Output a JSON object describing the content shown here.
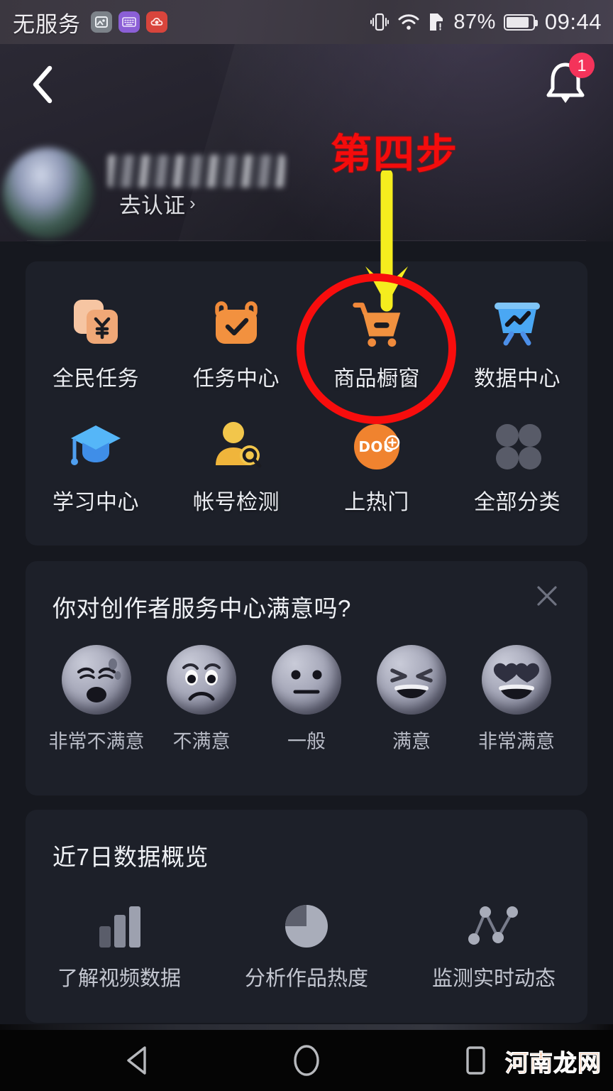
{
  "status_bar": {
    "carrier": "无服务",
    "icons": [
      "screenshot-icon",
      "keyboard-icon",
      "cloud-icon"
    ],
    "vibrate_icon": "vibrate-icon",
    "wifi_icon": "wifi-icon",
    "sim_alert_icon": "sim-alert-icon",
    "battery_percent": "87%",
    "battery_icon": "battery-icon",
    "clock": "09:44"
  },
  "header": {
    "back_icon": "back-chevron-icon",
    "bell_icon": "bell-icon",
    "bell_badge": "1",
    "avatar": "avatar",
    "username": "",
    "verify_label": "去认证",
    "verify_chevron": "›"
  },
  "annotation": {
    "step_text": "第四步",
    "arrow": "down-arrow-annotation",
    "highlight_circle": "red-highlight-circle",
    "arrow_color": "#f5ed1e",
    "circle_color": "#f80d0d",
    "text_color": "#f40c0c"
  },
  "grid": {
    "row1": [
      {
        "label": "全民任务",
        "icon": "yen-cards-icon"
      },
      {
        "label": "任务中心",
        "icon": "task-check-icon"
      },
      {
        "label": "商品橱窗",
        "icon": "shopping-cart-icon"
      },
      {
        "label": "数据中心",
        "icon": "data-board-icon"
      }
    ],
    "row2": [
      {
        "label": "学习中心",
        "icon": "graduation-cap-icon"
      },
      {
        "label": "帐号检测",
        "icon": "account-search-icon"
      },
      {
        "label": "上热门",
        "icon": "dou-plus-icon"
      },
      {
        "label": "全部分类",
        "icon": "grid-dots-icon"
      }
    ]
  },
  "survey": {
    "title": "你对创作者服务中心满意吗?",
    "close_icon": "close-icon",
    "options": [
      {
        "label": "非常不满意",
        "icon": "face-very-dissatisfied"
      },
      {
        "label": "不满意",
        "icon": "face-dissatisfied"
      },
      {
        "label": "一般",
        "icon": "face-neutral"
      },
      {
        "label": "满意",
        "icon": "face-satisfied"
      },
      {
        "label": "非常满意",
        "icon": "face-very-satisfied"
      }
    ]
  },
  "data_overview": {
    "title": "近7日数据概览",
    "items": [
      {
        "label": "了解视频数据",
        "icon": "bar-chart-icon"
      },
      {
        "label": "分析作品热度",
        "icon": "pie-chart-icon"
      },
      {
        "label": "监测实时动态",
        "icon": "line-chart-icon"
      }
    ]
  },
  "navbar": {
    "back": "nav-back-triangle-icon",
    "home": "nav-home-circle-icon",
    "recents": "nav-recents-square-icon"
  },
  "watermark": {
    "chars": [
      "河",
      "南",
      "龙",
      "网"
    ]
  }
}
